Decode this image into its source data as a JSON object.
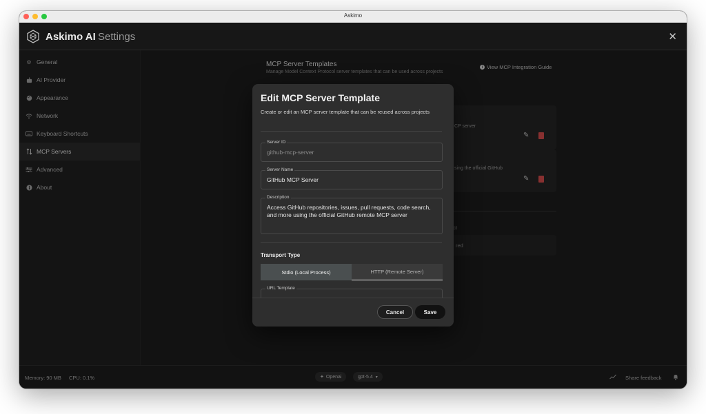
{
  "window": {
    "title": "Askimo"
  },
  "app": {
    "name": "Askimo AI",
    "section": "Settings"
  },
  "sidebar": {
    "items": [
      {
        "label": "General",
        "icon": "gear-icon"
      },
      {
        "label": "AI Provider",
        "icon": "robot-icon"
      },
      {
        "label": "Appearance",
        "icon": "palette-icon"
      },
      {
        "label": "Network",
        "icon": "wifi-icon"
      },
      {
        "label": "Keyboard Shortcuts",
        "icon": "keyboard-icon"
      },
      {
        "label": "MCP Servers",
        "icon": "plug-icon",
        "active": true
      },
      {
        "label": "Advanced",
        "icon": "sliders-icon"
      },
      {
        "label": "About",
        "icon": "info-icon"
      }
    ]
  },
  "main": {
    "title": "MCP Server Templates",
    "subtitle": "Manage Model Context Protocol server templates that can be used across projects",
    "guide_link": "View MCP Integration Guide",
    "card1_text": "CP server",
    "card2_text": "sing the official GitHub",
    "section_text": "ect",
    "box_text": "red"
  },
  "dialog": {
    "title": "Edit MCP Server Template",
    "subtitle": "Create or edit an MCP server template that can be reused across projects",
    "server_id": {
      "label": "Server ID",
      "value": "github-mcp-server"
    },
    "server_name": {
      "label": "Server Name",
      "value": "GitHub MCP Server"
    },
    "description": {
      "label": "Description",
      "value": "Access GitHub repositories, issues, pull requests, code search, and more using the official GitHub remote MCP server"
    },
    "transport": {
      "label": "Transport Type",
      "options": [
        "Stdio (Local Process)",
        "HTTP (Remote Server)"
      ],
      "selected": "Stdio (Local Process)"
    },
    "url_template": {
      "label": "URL Template"
    },
    "cancel_label": "Cancel",
    "save_label": "Save"
  },
  "status": {
    "memory": "Memory: 90 MB",
    "cpu": "CPU: 0.1%",
    "provider": "Openai",
    "model": "gpt-5.4",
    "share": "Share feedback"
  },
  "colors": {
    "accent_red": "#d24b4b",
    "background": "#1c1c1c",
    "dialog": "#2e2e2e"
  }
}
